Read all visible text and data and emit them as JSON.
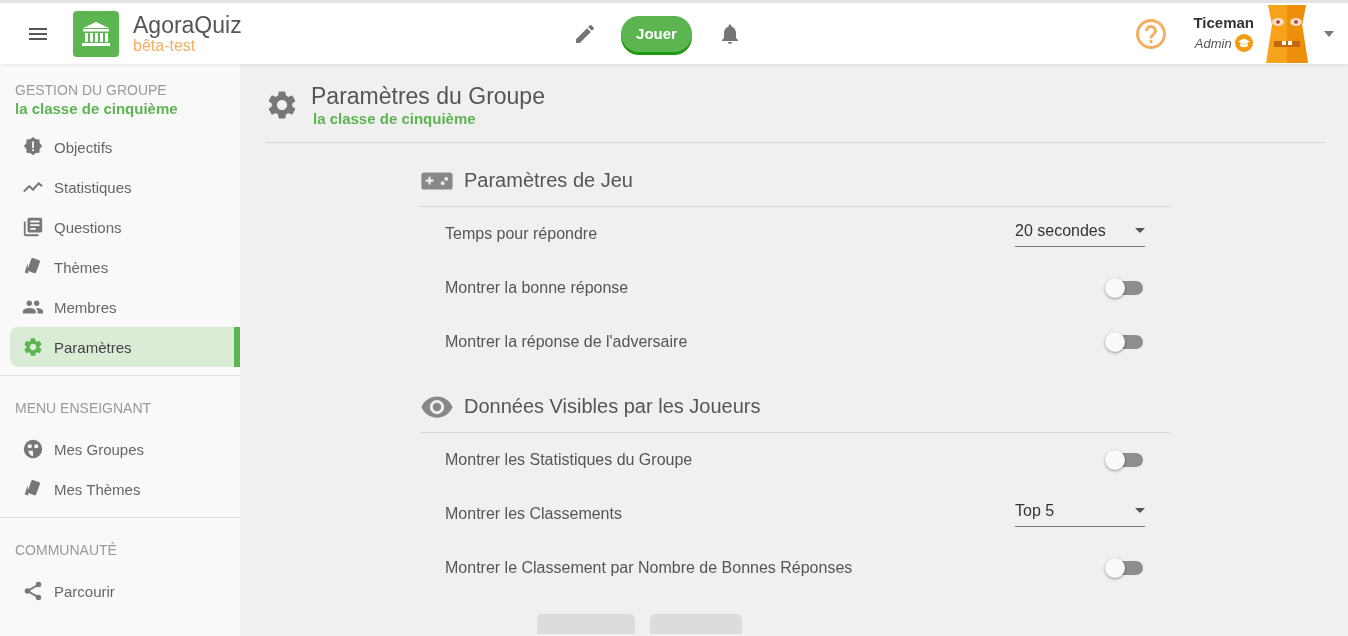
{
  "header": {
    "app_name": "AgoraQuiz",
    "app_tag": "bêta-test",
    "play_button": "Jouer",
    "user": {
      "name": "Ticeman",
      "role": "Admin"
    }
  },
  "sidebar": {
    "sections": [
      {
        "heading": "GESTION DU GROUPE",
        "subtitle": "la classe de cinquième",
        "items": [
          {
            "label": "Objectifs",
            "selected": false
          },
          {
            "label": "Statistiques",
            "selected": false
          },
          {
            "label": "Questions",
            "selected": false
          },
          {
            "label": "Thèmes",
            "selected": false
          },
          {
            "label": "Membres",
            "selected": false
          },
          {
            "label": "Paramètres",
            "selected": true
          }
        ]
      },
      {
        "heading": "MENU ENSEIGNANT",
        "items": [
          {
            "label": "Mes Groupes",
            "selected": false
          },
          {
            "label": "Mes Thèmes",
            "selected": false
          }
        ]
      },
      {
        "heading": "COMMUNAUTÉ",
        "items": [
          {
            "label": "Parcourir",
            "selected": false
          }
        ]
      }
    ]
  },
  "page": {
    "title": "Paramètres du Groupe",
    "subtitle": "la classe de cinquième",
    "sections": [
      {
        "title": "Paramètres de Jeu",
        "rows": [
          {
            "kind": "select",
            "label": "Temps pour répondre",
            "value": "20 secondes"
          },
          {
            "kind": "toggle",
            "label": "Montrer la bonne réponse",
            "on": false
          },
          {
            "kind": "toggle",
            "label": "Montrer la réponse de l'adversaire",
            "on": false
          }
        ]
      },
      {
        "title": "Données Visibles par les Joueurs",
        "rows": [
          {
            "kind": "toggle",
            "label": "Montrer les Statistiques du Groupe",
            "on": false
          },
          {
            "kind": "select",
            "label": "Montrer les Classements",
            "value": "Top 5"
          },
          {
            "kind": "toggle",
            "label": "Montrer le Classement par Nombre de Bonnes Réponses",
            "on": false
          }
        ]
      }
    ]
  }
}
